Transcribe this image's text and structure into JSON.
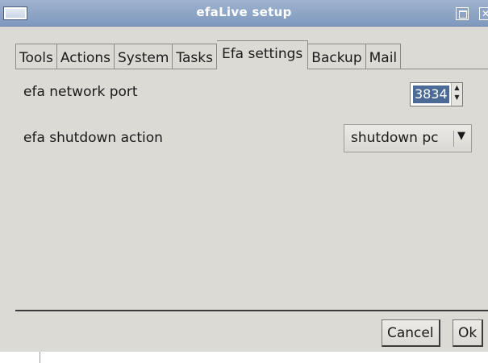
{
  "window": {
    "title": "efaLive setup"
  },
  "tabs": [
    {
      "label": "Tools",
      "active": false
    },
    {
      "label": "Actions",
      "active": false
    },
    {
      "label": "System",
      "active": false
    },
    {
      "label": "Tasks",
      "active": false
    },
    {
      "label": "Efa settings",
      "active": true
    },
    {
      "label": "Backup",
      "active": false
    },
    {
      "label": "Mail",
      "active": false
    }
  ],
  "settings": {
    "port": {
      "label": "efa network port",
      "value": "3834"
    },
    "shutdown": {
      "label": "efa shutdown action",
      "value": "shutdown pc"
    }
  },
  "buttons": {
    "cancel": "Cancel",
    "ok": "Ok"
  },
  "colors": {
    "titlebar": "#8ca3c6",
    "window_bg": "#dcdad5",
    "selection": "#4b6a95"
  }
}
